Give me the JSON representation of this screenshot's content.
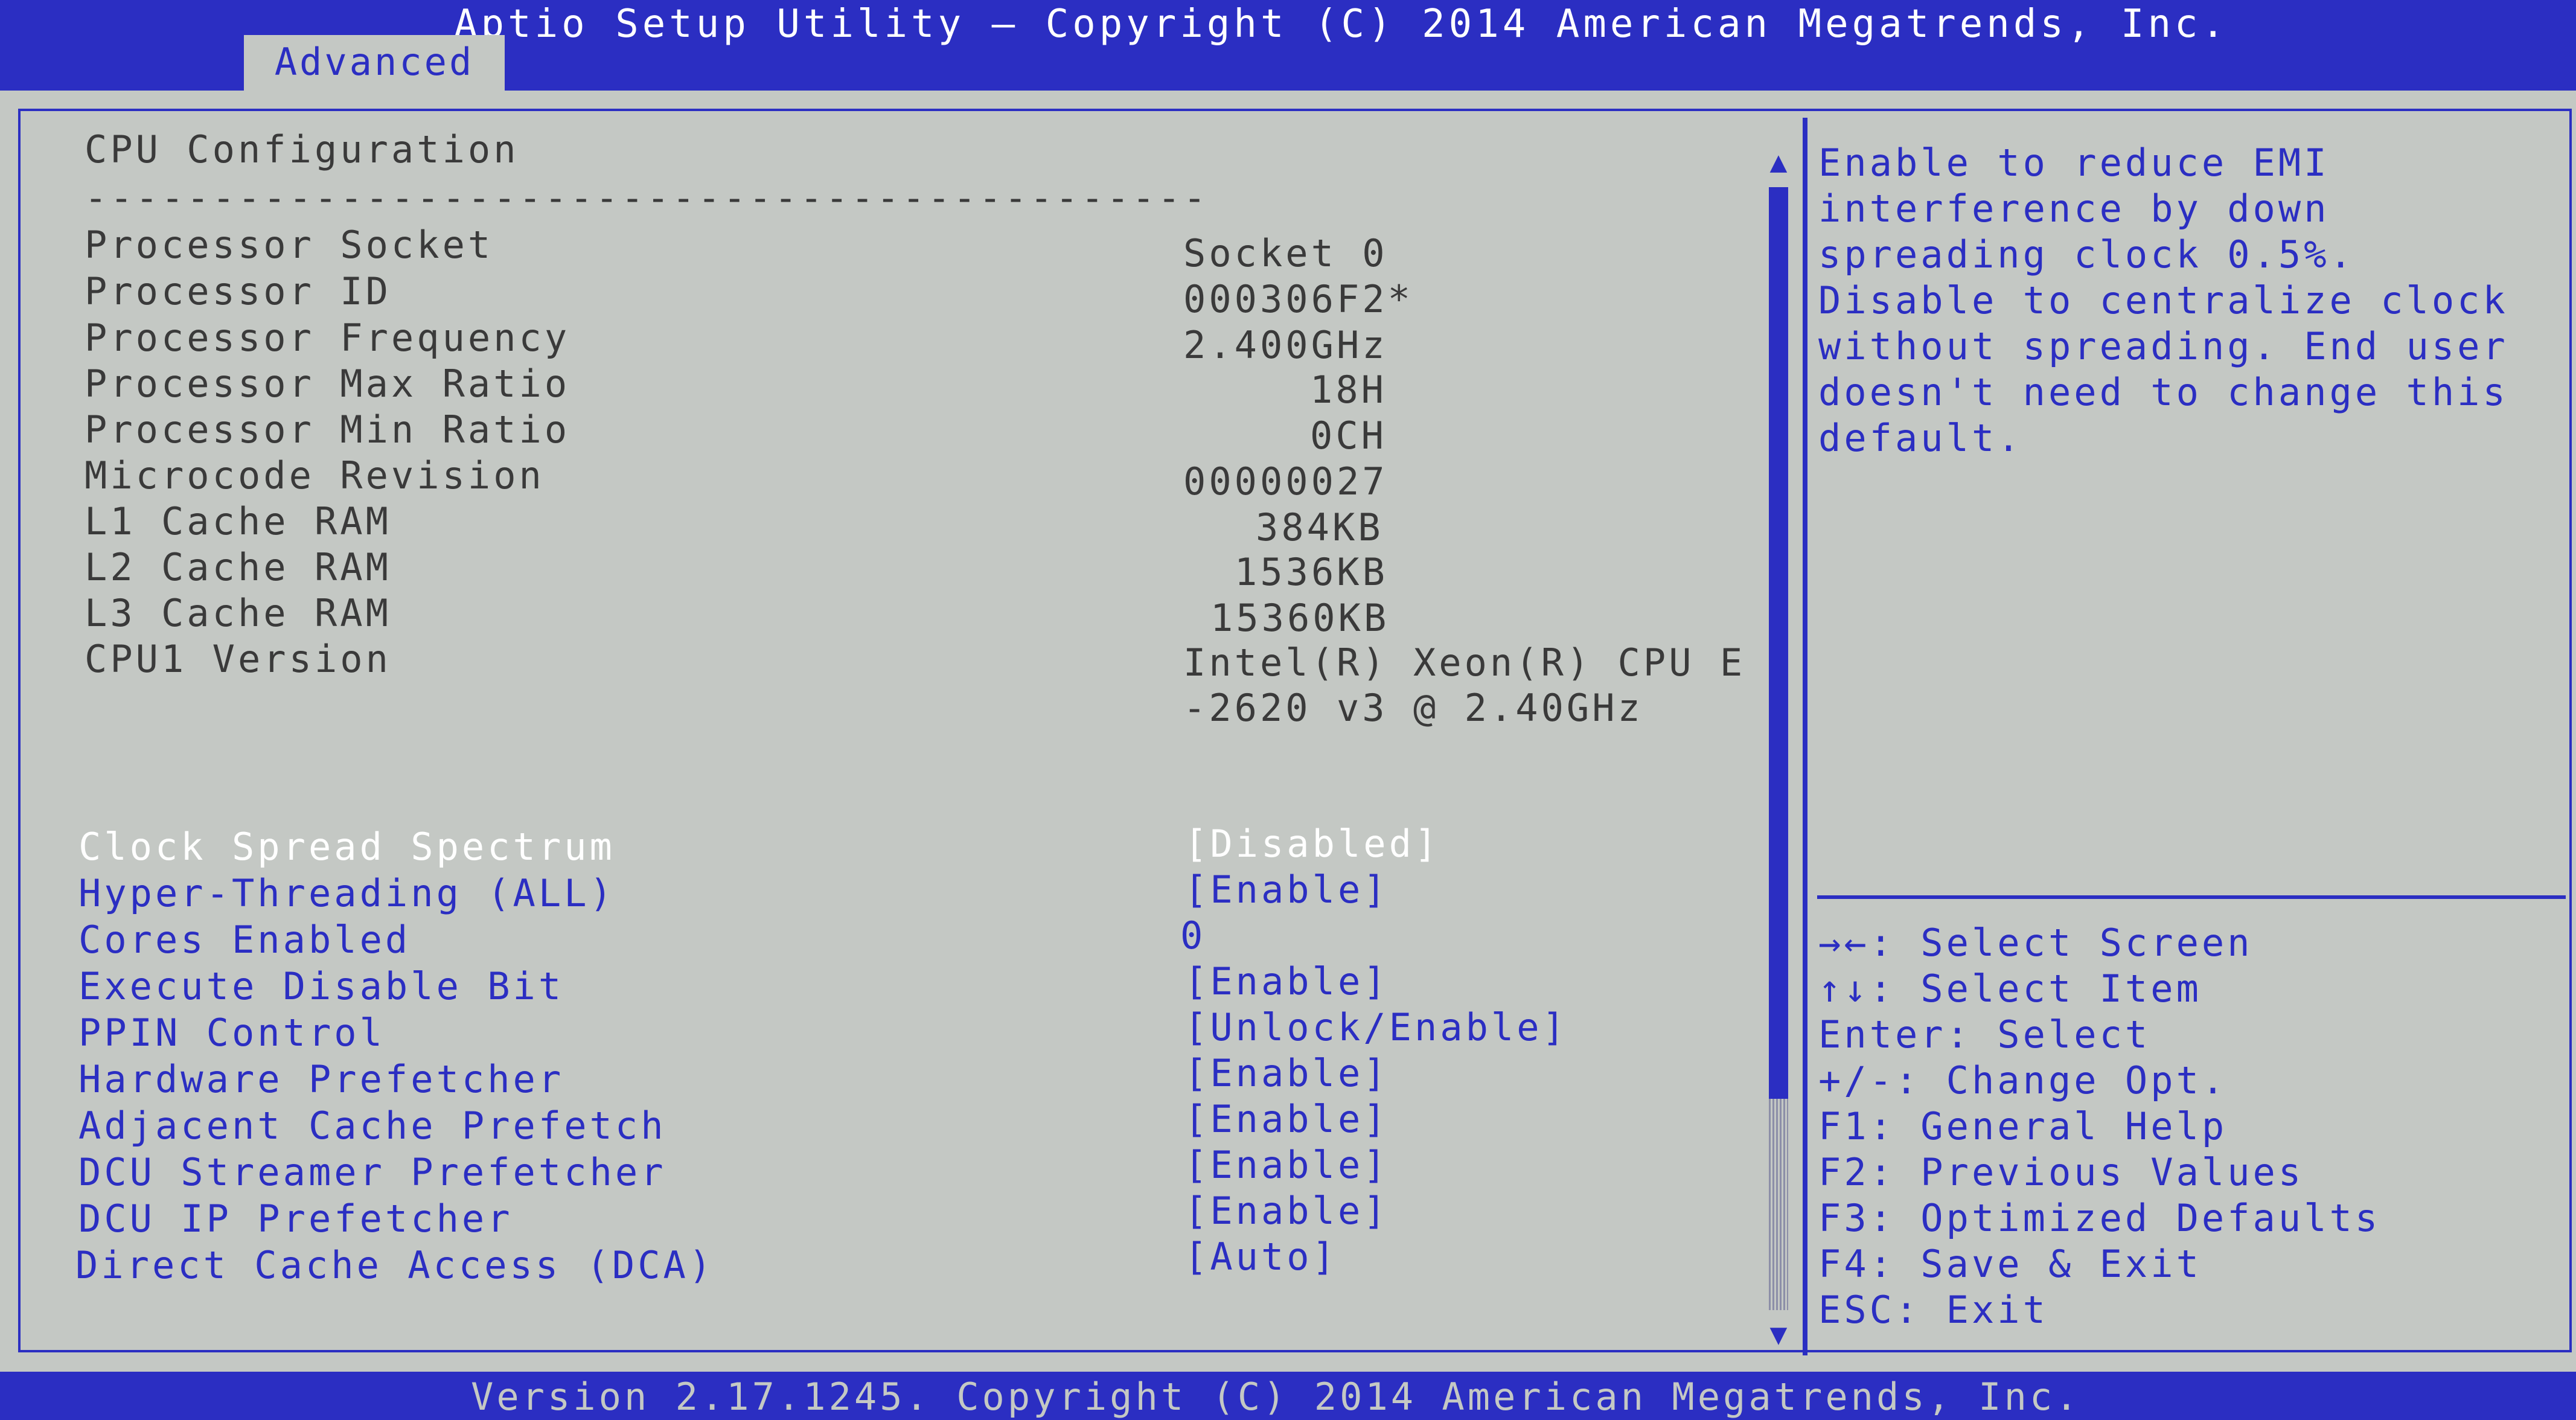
{
  "title": "Aptio Setup Utility – Copyright (C) 2014 American Megatrends, Inc.",
  "tab": "Advanced",
  "section_title": "CPU Configuration",
  "separator": "--------------------------------------------",
  "info_rows": [
    {
      "label": "Processor Socket",
      "value": "Socket 0"
    },
    {
      "label": "Processor ID",
      "value": "000306F2*"
    },
    {
      "label": "Processor Frequency",
      "value": "2.400GHz"
    },
    {
      "label": "Processor Max Ratio",
      "value": "18H"
    },
    {
      "label": "Processor Min Ratio",
      "value": "0CH"
    },
    {
      "label": "Microcode Revision",
      "value": "00000027"
    },
    {
      "label": "L1 Cache RAM",
      "value": "384KB"
    },
    {
      "label": "L2 Cache RAM",
      "value": "1536KB"
    },
    {
      "label": "L3 Cache RAM",
      "value": "15360KB"
    },
    {
      "label": "CPU1 Version",
      "value": "Intel(R) Xeon(R) CPU E"
    }
  ],
  "cpu_version_line2": "-2620 v3 @ 2.40GHz",
  "options": [
    {
      "label": "Clock Spread Spectrum",
      "value": "[Disabled]"
    },
    {
      "label": "Hyper-Threading (ALL)",
      "value": "[Enable]"
    },
    {
      "label": "Cores Enabled",
      "value": "0"
    },
    {
      "label": "Execute Disable Bit",
      "value": "[Enable]"
    },
    {
      "label": "PPIN Control",
      "value": "[Unlock/Enable]"
    },
    {
      "label": "Hardware Prefetcher",
      "value": "[Enable]"
    },
    {
      "label": "Adjacent Cache Prefetch",
      "value": "[Enable]"
    },
    {
      "label": "DCU Streamer Prefetcher",
      "value": "[Enable]"
    },
    {
      "label": "DCU IP Prefetcher",
      "value": "[Enable]"
    },
    {
      "label": "Direct Cache Access (DCA)",
      "value": "[Auto]"
    }
  ],
  "help_lines": [
    "Enable to reduce EMI",
    "interference by down",
    "spreading clock 0.5%.",
    "Disable to centralize clock",
    "without spreading. End user",
    "doesn't need to change this",
    "default."
  ],
  "key_help": [
    "→←: Select Screen",
    "↑↓: Select Item",
    "Enter: Select",
    "+/-: Change Opt.",
    "F1: General Help",
    "F2: Previous Values",
    "F3: Optimized Defaults",
    "F4: Save & Exit",
    "ESC: Exit"
  ],
  "footer": "Version 2.17.1245. Copyright (C) 2014 American Megatrends, Inc.",
  "colors": {
    "bios_blue": "#2b2ec2",
    "panel_gray": "#c4c8c4",
    "text_dark": "#3a3a3a",
    "highlight": "#ffffff"
  }
}
